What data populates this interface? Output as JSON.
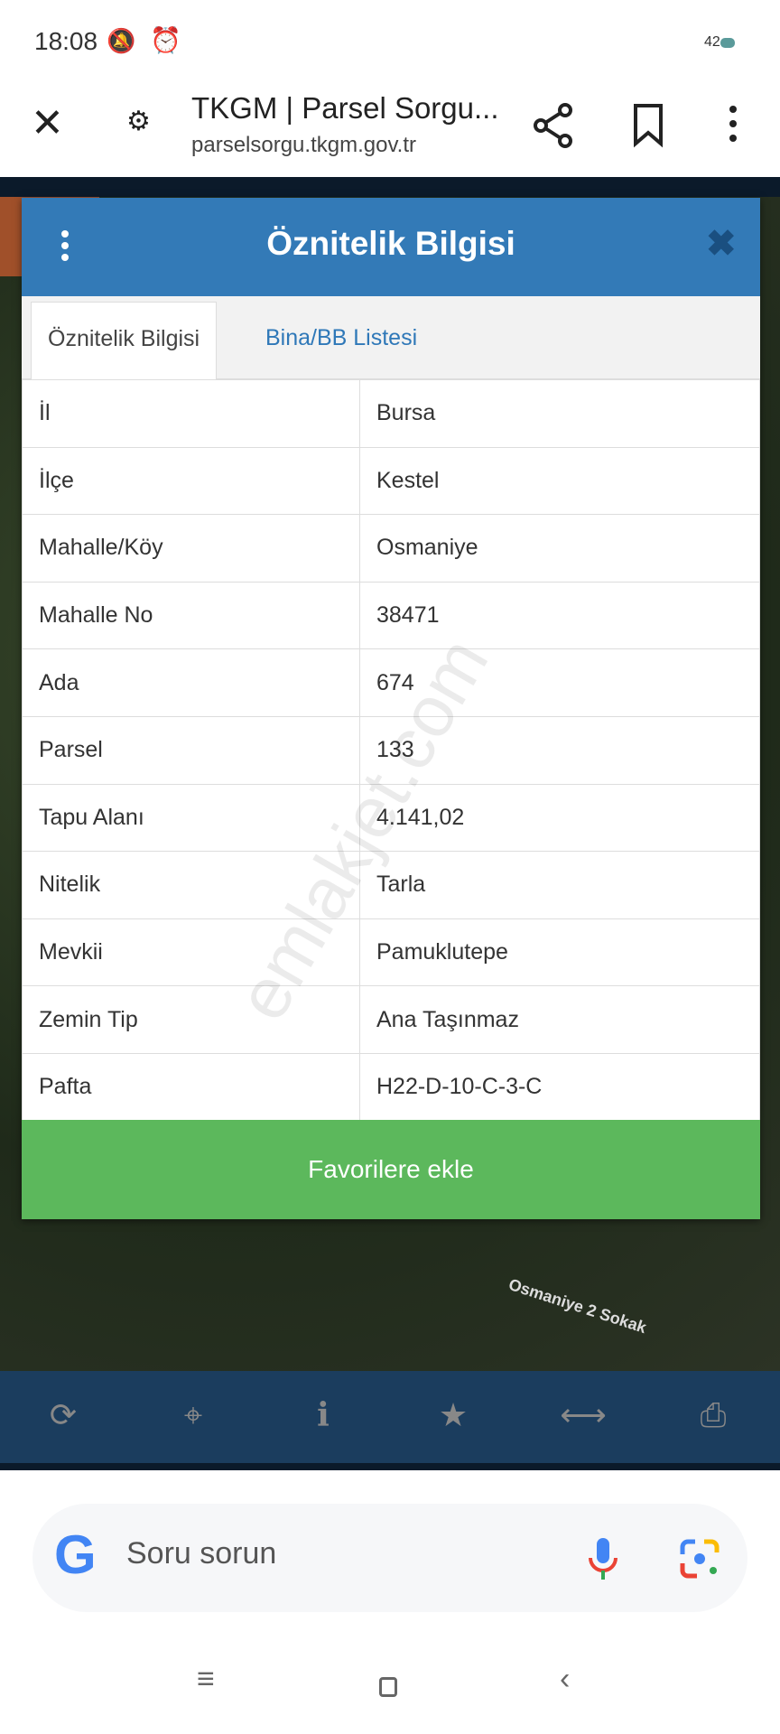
{
  "status_bar": {
    "time": "18:08",
    "battery": "42"
  },
  "browser": {
    "title": "TKGM | Parsel Sorgu...",
    "url": "parselsorgu.tkgm.gov.tr"
  },
  "map": {
    "road_label": "Osmaniye 2 Sokak"
  },
  "modal": {
    "title": "Öznitelik Bilgisi",
    "tabs": [
      {
        "label": "Öznitelik Bilgisi",
        "active": true
      },
      {
        "label": "Bina/BB Listesi",
        "active": false
      }
    ],
    "rows": [
      {
        "key": "İl",
        "value": "Bursa"
      },
      {
        "key": "İlçe",
        "value": "Kestel"
      },
      {
        "key": "Mahalle/Köy",
        "value": "Osmaniye"
      },
      {
        "key": "Mahalle No",
        "value": "38471"
      },
      {
        "key": "Ada",
        "value": "674"
      },
      {
        "key": "Parsel",
        "value": "133"
      },
      {
        "key": "Tapu Alanı",
        "value": "4.141,02"
      },
      {
        "key": "Nitelik",
        "value": "Tarla"
      },
      {
        "key": "Mevkii",
        "value": "Pamuklutepe"
      },
      {
        "key": "Zemin Tip",
        "value": "Ana Taşınmaz"
      },
      {
        "key": "Pafta",
        "value": "H22-D-10-C-3-C"
      }
    ],
    "favorite_button": "Favorilere ekle",
    "watermark": "emlakjet.com"
  },
  "bottom_toolbar": {
    "icons": [
      "refresh-icon",
      "locate-icon",
      "info-icon",
      "star-icon",
      "measure-icon",
      "print-icon"
    ]
  },
  "google_search": {
    "placeholder": "Soru sorun"
  },
  "colors": {
    "header": "#337ab7",
    "favorite": "#5cb85c",
    "toolbar": "#1b3d5e"
  }
}
